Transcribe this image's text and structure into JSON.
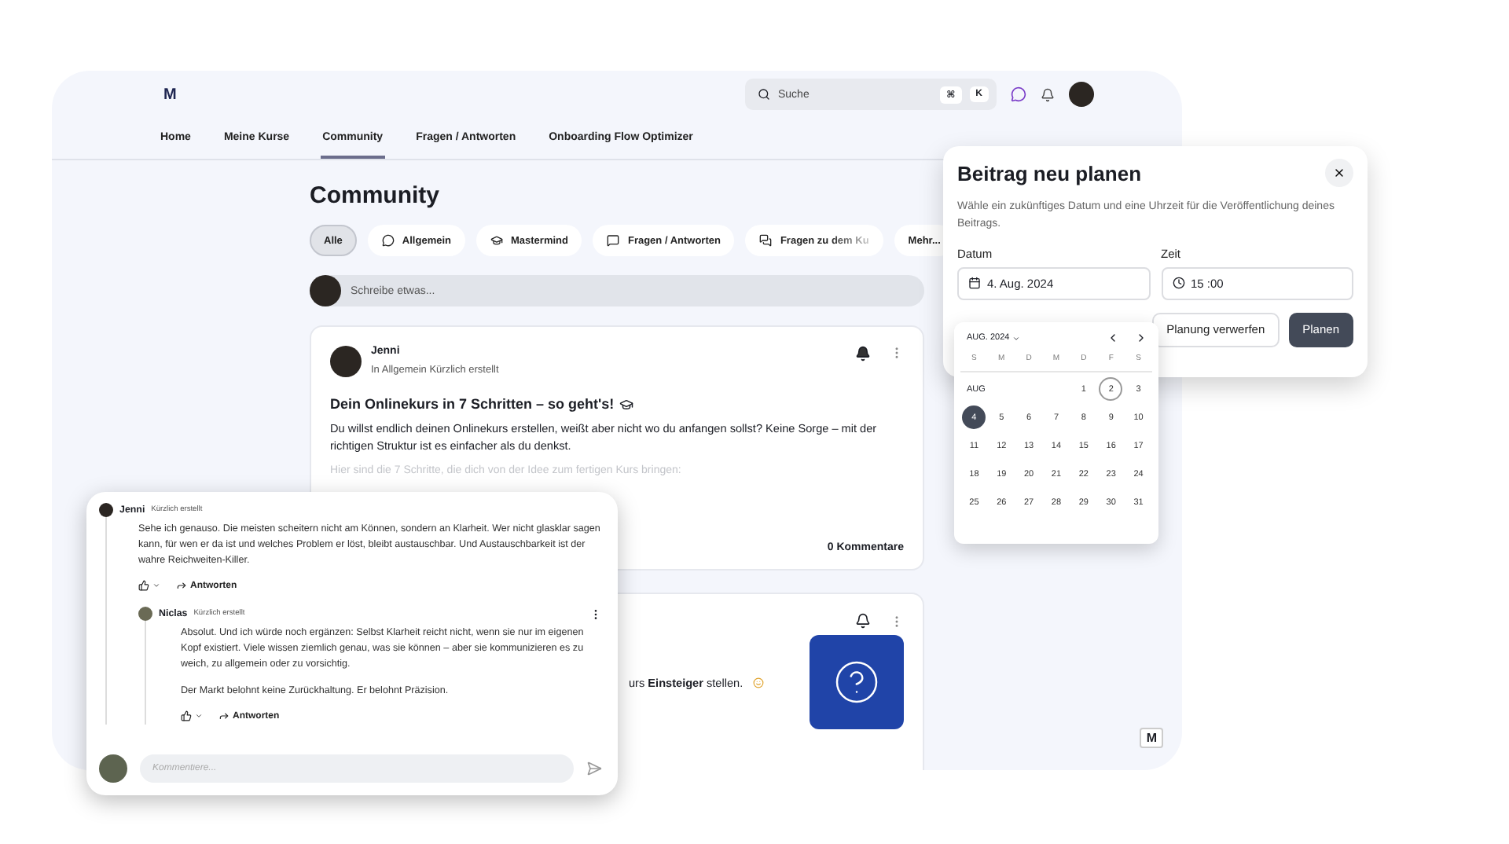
{
  "app": {
    "logo": "M",
    "search": {
      "placeholder": "Suche",
      "shortcut_keys": [
        "⌘",
        "K"
      ]
    },
    "nav": [
      {
        "label": "Home",
        "selected": false
      },
      {
        "label": "Meine Kurse",
        "selected": false
      },
      {
        "label": "Community",
        "selected": true
      },
      {
        "label": "Fragen / Antworten",
        "selected": false
      },
      {
        "label": "Onboarding Flow Optimizer",
        "selected": false
      }
    ],
    "page_title": "Community",
    "chips": [
      {
        "label": "Alle",
        "selected": true
      },
      {
        "label": "Allgemein",
        "selected": false
      },
      {
        "label": "Mastermind",
        "selected": false
      },
      {
        "label": "Fragen / Antworten",
        "selected": false
      },
      {
        "label": "Fragen zu dem Ku",
        "selected": false
      },
      {
        "label": "Mehr...",
        "selected": false
      }
    ],
    "composer": {
      "placeholder": "Schreibe etwas..."
    },
    "posts": [
      {
        "author": "Jenni",
        "meta": "In Allgemein Kürzlich erstellt",
        "subscribed": true,
        "title": "Dein Onlinekurs in 7 Schritten – so geht's!",
        "body": "Du willst endlich deinen Onlinekurs erstellen, weißt aber nicht wo du anfangen sollst? Keine Sorge – mit der richtigen Struktur ist es einfacher als du denkst.",
        "faded": "Hier sind die 7 Schritte, die dich von der Idee zum fertigen Kurs bringen:",
        "comments": "0 Kommentare"
      },
      {
        "subscribed": false,
        "body": "urs **Einsteiger** stellen.",
        "has_thumbnail": true
      }
    ],
    "corner_logo": "M"
  },
  "schedule_dialog": {
    "title": "Beitrag neu planen",
    "description": "Wähle ein zukünftiges Datum und eine Uhrzeit für die Veröffentlichung deines Beitrags.",
    "date_label": "Datum",
    "date_value": "4. Aug. 2024",
    "time_label": "Zeit",
    "time_value": "15 :00",
    "buttons": [
      {
        "label": "Planung verwerfen",
        "kind": "secondary"
      },
      {
        "label": "Planen",
        "kind": "primary"
      }
    ]
  },
  "date_picker": {
    "month": "AUG. 2024",
    "weekdays": [
      "S",
      "M",
      "D",
      "M",
      "D",
      "F",
      "S"
    ],
    "month_row_label": "AUG",
    "weeks": [
      [
        {
          "day": "1",
          "selected": false,
          "today": false
        },
        {
          "day": "2",
          "selected": false,
          "today": true
        },
        {
          "day": "3",
          "selected": false,
          "today": false
        }
      ],
      [
        {
          "day": "4",
          "selected": true,
          "today": false
        },
        {
          "day": "5",
          "selected": false,
          "today": false
        },
        {
          "day": "6",
          "selected": false,
          "today": false
        },
        {
          "day": "7",
          "selected": false,
          "today": false
        },
        {
          "day": "8",
          "selected": false,
          "today": false
        },
        {
          "day": "9",
          "selected": false,
          "today": false
        },
        {
          "day": "10",
          "selected": false,
          "today": false
        }
      ],
      [
        {
          "day": "11",
          "selected": false,
          "today": false
        },
        {
          "day": "12",
          "selected": false,
          "today": false
        },
        {
          "day": "13",
          "selected": false,
          "today": false
        },
        {
          "day": "14",
          "selected": false,
          "today": false
        },
        {
          "day": "15",
          "selected": false,
          "today": false
        },
        {
          "day": "16",
          "selected": false,
          "today": false
        },
        {
          "day": "17",
          "selected": false,
          "today": false
        }
      ],
      [
        {
          "day": "18",
          "selected": false,
          "today": false
        },
        {
          "day": "19",
          "selected": false,
          "today": false
        },
        {
          "day": "20",
          "selected": false,
          "today": false
        },
        {
          "day": "21",
          "selected": false,
          "today": false
        },
        {
          "day": "22",
          "selected": false,
          "today": false
        },
        {
          "day": "23",
          "selected": false,
          "today": false
        },
        {
          "day": "24",
          "selected": false,
          "today": false
        }
      ],
      [
        {
          "day": "25",
          "selected": false,
          "today": false
        },
        {
          "day": "26",
          "selected": false,
          "today": false
        },
        {
          "day": "27",
          "selected": false,
          "today": false
        },
        {
          "day": "28",
          "selected": false,
          "today": false
        },
        {
          "day": "29",
          "selected": false,
          "today": false
        },
        {
          "day": "30",
          "selected": false,
          "today": false
        },
        {
          "day": "31",
          "selected": false,
          "today": false
        }
      ]
    ]
  },
  "comment_thread": {
    "comments": [
      {
        "author": "Jenni",
        "time": "Kürzlich erstellt",
        "paragraphs": [
          "Sehe ich genauso. Die meisten scheitern nicht am Können, sondern an Klarheit. Wer nicht glasklar sagen kann, für wen er da ist und welches Problem er löst, bleibt austauschbar. Und Austauschbarkeit ist der wahre Reichweiten-Killer."
        ],
        "reply": "Antworten",
        "replies": [
          {
            "author": "Niclas",
            "time": "Kürzlich erstellt",
            "paragraphs": [
              "Absolut. Und ich würde noch ergänzen: Selbst Klarheit reicht nicht, wenn sie nur im eigenen Kopf existiert. Viele wissen ziemlich genau, was sie können – aber sie kommunizieren es zu weich, zu allgemein oder zu vorsichtig.",
              "Der Markt belohnt keine Zurückhaltung. Er belohnt Präzision."
            ],
            "reply": "Antworten"
          }
        ]
      }
    ],
    "input": {
      "placeholder": "Kommentiere..."
    }
  }
}
